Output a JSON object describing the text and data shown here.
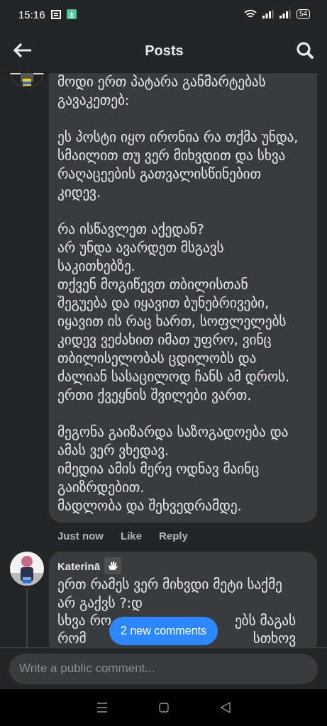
{
  "status_bar": {
    "time": "15:16",
    "battery": "54"
  },
  "header": {
    "title": "Posts"
  },
  "comments": [
    {
      "kind": "reply",
      "avatar": {
        "kind": "picture"
      },
      "paragraphs": [
        "მოდი ერთ პატარა განმარტებას\nგავაკეთებ:",
        "ეს პოსტი იყო ირონია რა თქმა უნდა,\nსმაილით თუ ვერ მიხვდით და სხვა\nრაღაცეების გათვალისწინებით\nკიდევ.",
        "რა ისწავლეთ აქედან?\nარ უნდა ავარდეთ მსგავს\nსაკითხებზე.\nთქვენ მოგიწევთ თბილისთან\nშეგუება და იყავით ბუნებრივები,\nიყავით ის რაც ხართ, სოფლელებს\nკიდევ ვეძახით იმათ უფრო, ვინც\nთბილისელობას ცდილობს და\nძალიან სასაცილოდ ჩანს ამ დროს.\nერთი ქვეყნის შვილები ვართ.",
        "მეგონა გაიზარდა საზოგადოება და\nამას ვერ ვხედავ.\nიმედია ამის მერე ოდნავ მაინც\nგაიზრდებით.\nმადლობა და შეხვედრამდე."
      ],
      "time": "Just now",
      "actions": [
        "Like",
        "Reply"
      ]
    },
    {
      "kind": "comment",
      "avatar": {
        "kind": "picture"
      },
      "author": "Katerinā",
      "paragraphs": [
        "ერთ რამეს ვერ მიხვდი მეტი საქმე\nარ გაქვს ?:დ"
      ],
      "covered_lines": [
        [
          "სხვა რო",
          "ებს მაგას"
        ],
        [
          "რომ",
          "სთხოვ"
        ]
      ]
    }
  ],
  "new_comments_button": {
    "label": "2 new comments"
  },
  "composer": {
    "placeholder": "Write a public comment..."
  }
}
